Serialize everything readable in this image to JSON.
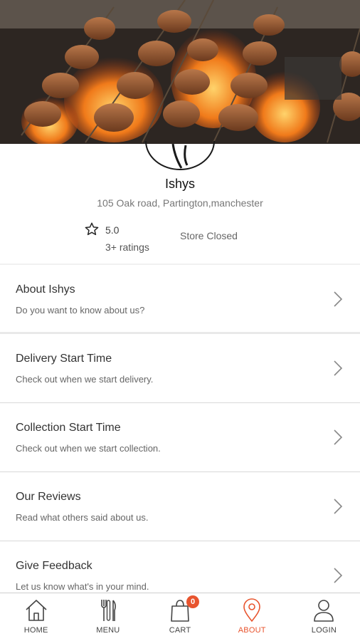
{
  "store": {
    "name": "Ishys",
    "address": "105 Oak road, Partington,manchester",
    "rating": "5.0",
    "rating_count": "3+ ratings",
    "status": "Store Closed",
    "logo_text": "Ishys"
  },
  "menu": [
    {
      "title": "About Ishys",
      "subtitle": "Do you want to know about us?"
    },
    {
      "title": "Delivery Start Time",
      "subtitle": "Check out when we start delivery."
    },
    {
      "title": "Collection Start Time",
      "subtitle": "Check out when we start collection."
    },
    {
      "title": "Our Reviews",
      "subtitle": "Read what others said about us."
    },
    {
      "title": "Give Feedback",
      "subtitle": "Let us know what's in your mind."
    }
  ],
  "nav": [
    {
      "label": "HOME",
      "icon": "home-icon"
    },
    {
      "label": "MENU",
      "icon": "cutlery-icon"
    },
    {
      "label": "CART",
      "icon": "shopping-bag-icon"
    },
    {
      "label": "ABOUT",
      "icon": "location-pin-icon"
    },
    {
      "label": "LOGIN",
      "icon": "user-icon"
    }
  ],
  "cart_count": "0",
  "colors": {
    "accent": "#e8542e",
    "text": "#333333",
    "muted": "#666666"
  }
}
